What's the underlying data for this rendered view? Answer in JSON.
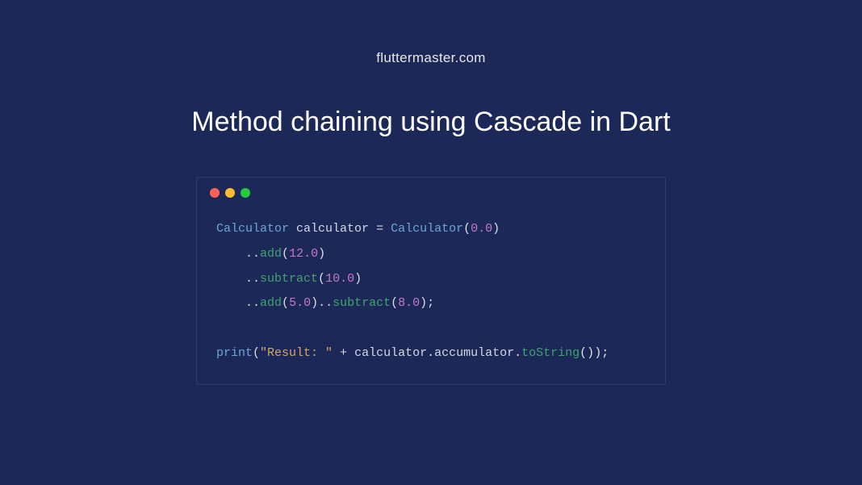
{
  "header": {
    "site": "fluttermaster.com",
    "title": "Method chaining using Cascade in Dart"
  },
  "window": {
    "dots": [
      "red",
      "yellow",
      "green"
    ]
  },
  "code": {
    "line1": {
      "type": "Calculator",
      "varName": "calculator",
      "equals": "=",
      "constructor": "Calculator",
      "openParen": "(",
      "arg": "0.0",
      "closeParen": ")"
    },
    "line2": {
      "indent": "    ",
      "cascade": "..",
      "method": "add",
      "open": "(",
      "arg": "12.0",
      "close": ")"
    },
    "line3": {
      "indent": "    ",
      "cascade": "..",
      "method": "subtract",
      "open": "(",
      "arg": "10.0",
      "close": ")"
    },
    "line4": {
      "indent": "    ",
      "cascade1": "..",
      "method1": "add",
      "open1": "(",
      "arg1": "5.0",
      "close1": ")",
      "cascade2": "..",
      "method2": "subtract",
      "open2": "(",
      "arg2": "8.0",
      "close2": ")",
      "semi": ";"
    },
    "line6": {
      "func": "print",
      "open": "(",
      "string": "\"Result: \"",
      "plus": " + ",
      "obj": "calculator",
      "dot1": ".",
      "prop": "accumulator",
      "dot2": ".",
      "toStr": "toString",
      "callOpen": "(",
      "callClose": ")",
      "close": ")",
      "semi": ";"
    }
  }
}
